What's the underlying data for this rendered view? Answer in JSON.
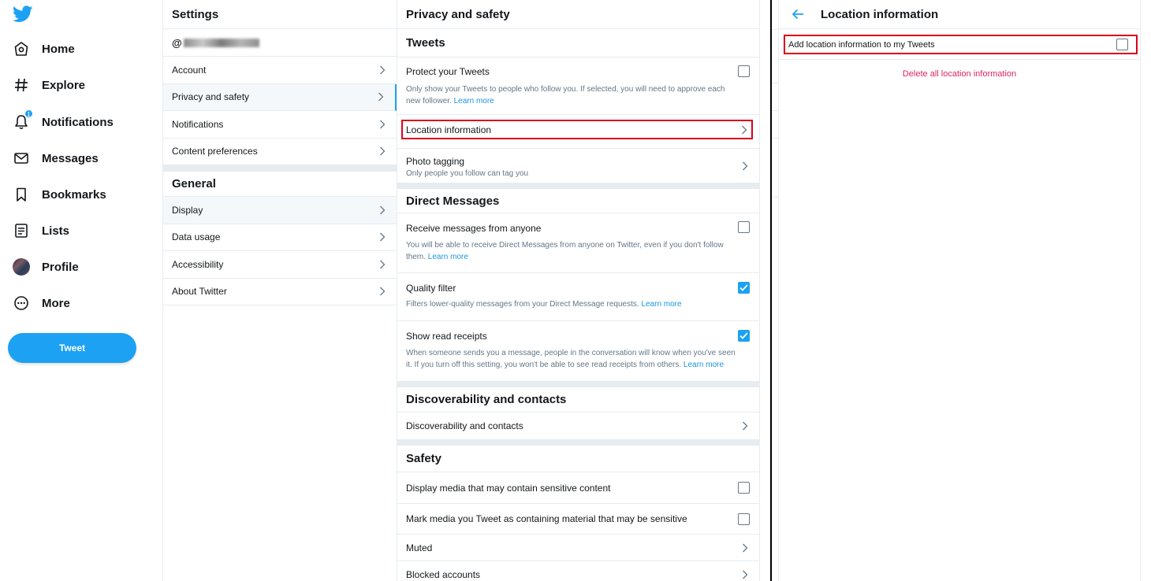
{
  "colors": {
    "brand": "#1da1f2",
    "link": "#1b95e0",
    "danger": "#e0245e",
    "highlight": "#d9001b"
  },
  "nav": {
    "logo_icon": "twitter-bird-icon",
    "items": [
      {
        "label": "Home",
        "icon": "home-icon"
      },
      {
        "label": "Explore",
        "icon": "hashtag-icon"
      },
      {
        "label": "Notifications",
        "icon": "bell-icon",
        "badge": "1"
      },
      {
        "label": "Messages",
        "icon": "envelope-icon"
      },
      {
        "label": "Bookmarks",
        "icon": "bookmark-icon"
      },
      {
        "label": "Lists",
        "icon": "list-icon"
      },
      {
        "label": "Profile",
        "icon": "avatar"
      },
      {
        "label": "More",
        "icon": "more-icon"
      }
    ],
    "tweet_button": "Tweet"
  },
  "settings": {
    "title": "Settings",
    "handle_prefix": "@",
    "account_items": [
      {
        "label": "Account"
      },
      {
        "label": "Privacy and safety",
        "active": true
      },
      {
        "label": "Notifications"
      },
      {
        "label": "Content preferences"
      }
    ],
    "general_title": "General",
    "general_items": [
      {
        "label": "Display"
      },
      {
        "label": "Data usage"
      },
      {
        "label": "Accessibility"
      },
      {
        "label": "About Twitter"
      }
    ]
  },
  "privacy": {
    "title": "Privacy and safety",
    "tweets": {
      "title": "Tweets",
      "protect": {
        "label": "Protect your Tweets",
        "desc": "Only show your Tweets to people who follow you. If selected, you will need to approve each new follower.",
        "link": "Learn more",
        "checked": false
      },
      "location": {
        "label": "Location information"
      },
      "photo": {
        "label": "Photo tagging",
        "desc": "Only people you follow can tag you"
      }
    },
    "dm": {
      "title": "Direct Messages",
      "receive": {
        "label": "Receive messages from anyone",
        "desc": "You will be able to receive Direct Messages from anyone on Twitter, even if you don't follow them.",
        "link": "Learn more",
        "checked": false
      },
      "quality": {
        "label": "Quality filter",
        "desc": "Filters lower-quality messages from your Direct Message requests.",
        "link": "Learn more",
        "checked": true
      },
      "receipts": {
        "label": "Show read receipts",
        "desc": "When someone sends you a message, people in the conversation will know when you've seen it. If you turn off this setting, you won't be able to see read receipts from others.",
        "link": "Learn more",
        "checked": true
      }
    },
    "discover": {
      "title": "Discoverability and contacts",
      "item": "Discoverability and contacts"
    },
    "safety": {
      "title": "Safety",
      "sensitive_display": {
        "label": "Display media that may contain sensitive content",
        "checked": false
      },
      "sensitive_mark": {
        "label": "Mark media you Tweet as containing material that may be sensitive",
        "checked": false
      },
      "muted": "Muted",
      "blocked": "Blocked accounts"
    }
  },
  "location": {
    "title": "Location information",
    "add_label": "Add location information to my Tweets",
    "add_checked": false,
    "delete_label": "Delete all location information"
  }
}
